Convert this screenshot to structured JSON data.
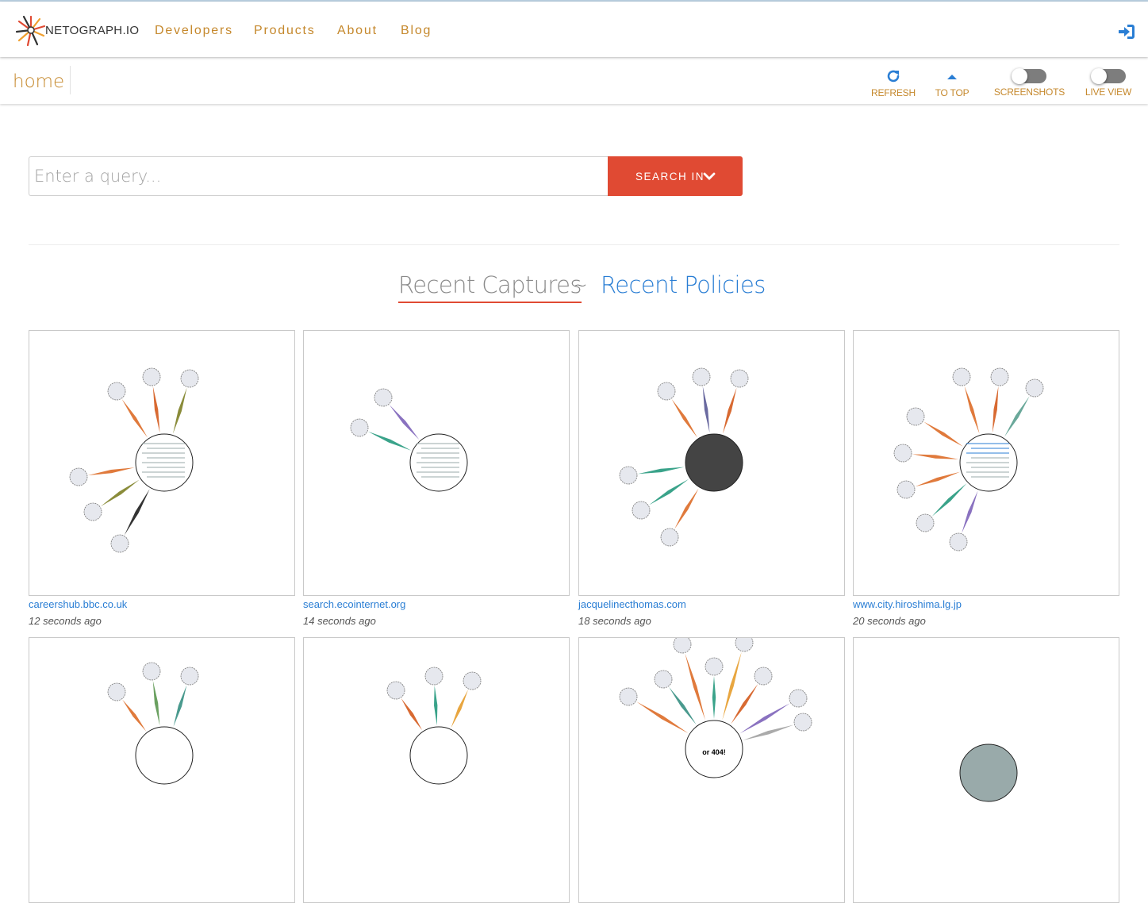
{
  "navbar": {
    "logo_text": "NETOGRAPH.IO",
    "links": [
      {
        "label": "Developers"
      },
      {
        "label": "Products"
      },
      {
        "label": "About"
      },
      {
        "label": "Blog"
      }
    ],
    "login_icon": "sign-in-icon"
  },
  "subbar": {
    "page_title": "home",
    "tools": {
      "refresh": {
        "label": "REFRESH",
        "icon": "refresh-icon"
      },
      "to_top": {
        "label": "TO TOP",
        "icon": "caret-up-icon"
      },
      "screenshots": {
        "label": "SCREENSHOTS",
        "enabled": false
      },
      "live_view": {
        "label": "LIVE VIEW",
        "enabled": false
      }
    }
  },
  "search": {
    "placeholder": "Enter a query...",
    "button_label": "SEARCH IN",
    "button_icon": "chevron-down-icon"
  },
  "headings": {
    "recent_captures": "Recent Captures",
    "separator": "~",
    "recent_policies": "Recent Policies",
    "active": "recent_captures"
  },
  "captures": [
    {
      "url": "careershub.bbc.co.uk",
      "time": "12 seconds ago"
    },
    {
      "url": "search.ecointernet.org",
      "time": "14 seconds ago"
    },
    {
      "url": "jacquelinecthomas.com",
      "time": "18 seconds ago"
    },
    {
      "url": "www.city.hiroshima.lg.jp",
      "time": "20 seconds ago"
    },
    {
      "url": "",
      "time": ""
    },
    {
      "url": "",
      "time": ""
    },
    {
      "url": "",
      "time": "",
      "center_text": "or 404!"
    },
    {
      "url": "",
      "time": ""
    }
  ],
  "colors": {
    "brand_gold": "#c5882c",
    "accent_red": "#e04a33",
    "link_blue": "#2a7ed4"
  }
}
